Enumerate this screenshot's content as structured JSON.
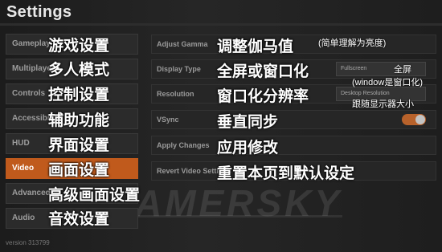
{
  "header": {
    "title": "Settings"
  },
  "watermark": "AMERSKY",
  "accent": "#c05a1c",
  "categories": [
    {
      "label_en": "Gameplay",
      "label_zh": "游戏设置",
      "active": false
    },
    {
      "label_en": "Multiplayer",
      "label_zh": "多人模式",
      "active": false
    },
    {
      "label_en": "Controls",
      "label_zh": "控制设置",
      "active": false
    },
    {
      "label_en": "Accessibility",
      "label_zh": "辅助功能",
      "active": false
    },
    {
      "label_en": "HUD",
      "label_zh": "界面设置",
      "active": false
    },
    {
      "label_en": "Video",
      "label_zh": "画面设置",
      "active": true
    },
    {
      "label_en": "Advanced",
      "label_zh": "高级画面设置",
      "active": false
    },
    {
      "label_en": "Audio",
      "label_zh": "音效设置",
      "active": false
    }
  ],
  "settings": [
    {
      "label_en": "Adjust Gamma",
      "label_zh": "调整伽马值",
      "note": "(简单理解为亮度)"
    },
    {
      "label_en": "Display Type",
      "label_zh": "全屏或窗口化",
      "value": "Fullscreen",
      "note": "全屏",
      "note2": "(window是窗口化)"
    },
    {
      "label_en": "Resolution",
      "label_zh": "窗口化分辨率",
      "value": "Desktop Resolution",
      "note": "跟随显示器大小"
    },
    {
      "label_en": "VSync",
      "label_zh": "垂直同步",
      "toggle_on": true
    },
    {
      "label_en": "Apply Changes",
      "label_zh": "应用修改"
    },
    {
      "label_en": "Revert Video Settings",
      "label_zh": "重置本页到默认设定"
    }
  ],
  "footer": {
    "version": "version 313799"
  }
}
